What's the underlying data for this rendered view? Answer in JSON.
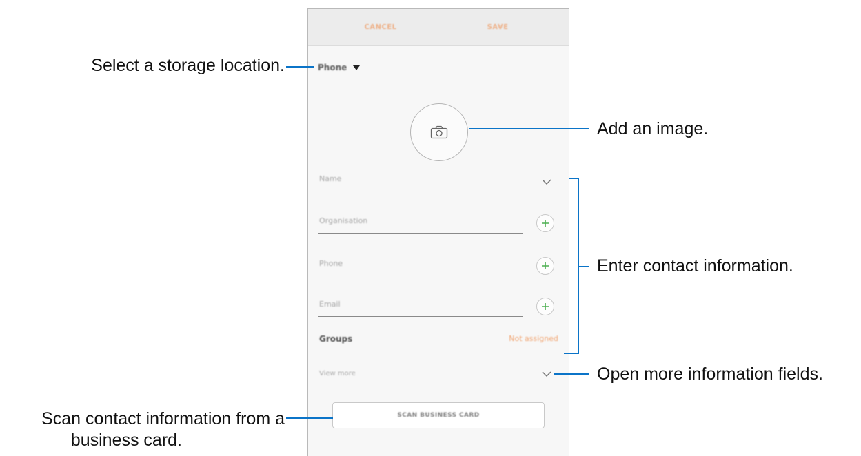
{
  "callouts": {
    "storage": "Select a storage location.",
    "image": "Add an image.",
    "contact": "Enter contact information.",
    "more_fields": "Open more information fields.",
    "scan_line1": "Scan contact information from a",
    "scan_line2": "business card."
  },
  "phone": {
    "action_bar": {
      "cancel_label": "CANCEL",
      "save_label": "SAVE"
    },
    "storage_label": "Phone",
    "fields": [
      {
        "placeholder": "Name",
        "icon": "chevron-down-icon"
      },
      {
        "placeholder": "Organisation",
        "icon": "add-icon"
      },
      {
        "placeholder": "Phone",
        "icon": "add-icon"
      },
      {
        "placeholder": "Email",
        "icon": "add-icon"
      }
    ],
    "groups": {
      "label": "Groups",
      "value": "Not assigned"
    },
    "view_more_label": "View more",
    "scan_button_label": "SCAN BUSINESS CARD"
  },
  "colors": {
    "accent": "#ef8f4f",
    "callout_line": "#0b74c8",
    "plus_icon": "#4caf50"
  }
}
